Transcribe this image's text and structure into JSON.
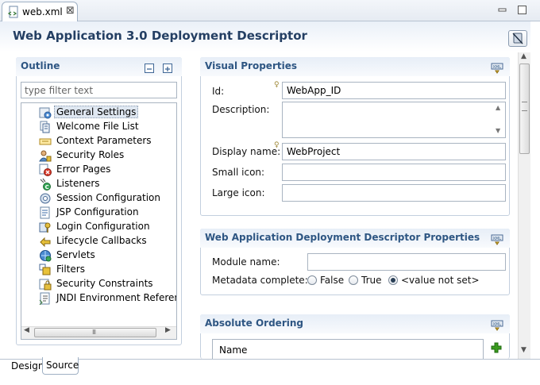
{
  "editor_tab": {
    "label": "web.xml",
    "close_glyph": "⊠"
  },
  "page": {
    "title": "Web Application 3.0 Deployment Descriptor"
  },
  "outline": {
    "title": "Outline",
    "filter_placeholder": "type filter text",
    "items": [
      {
        "label": "General Settings",
        "icon": "general-settings-icon",
        "selected": true
      },
      {
        "label": "Welcome File List",
        "icon": "welcome-file-list-icon"
      },
      {
        "label": "Context Parameters",
        "icon": "context-parameters-icon"
      },
      {
        "label": "Security Roles",
        "icon": "security-roles-icon"
      },
      {
        "label": "Error Pages",
        "icon": "error-pages-icon"
      },
      {
        "label": "Listeners",
        "icon": "listeners-icon"
      },
      {
        "label": "Session Configuration",
        "icon": "session-configuration-icon"
      },
      {
        "label": "JSP Configuration",
        "icon": "jsp-configuration-icon"
      },
      {
        "label": "Login Configuration",
        "icon": "login-configuration-icon"
      },
      {
        "label": "Lifecycle Callbacks",
        "icon": "lifecycle-callbacks-icon"
      },
      {
        "label": "Servlets",
        "icon": "servlets-icon"
      },
      {
        "label": "Filters",
        "icon": "filters-icon"
      },
      {
        "label": "Security Constraints",
        "icon": "security-constraints-icon"
      },
      {
        "label": "JNDI Environment Reference",
        "icon": "jndi-environment-reference-icon"
      }
    ],
    "scroll_grip": "III"
  },
  "visual_properties": {
    "title": "Visual Properties",
    "id_label": "Id:",
    "id_value": "WebApp_ID",
    "description_label": "Description:",
    "description_value": "",
    "display_name_label": "Display name:",
    "display_name_value": "WebProject",
    "small_icon_label": "Small icon:",
    "small_icon_value": "",
    "large_icon_label": "Large icon:",
    "large_icon_value": ""
  },
  "dd_properties": {
    "title": "Web Application Deployment Descriptor Properties",
    "module_name_label": "Module name:",
    "module_name_value": "",
    "metadata_label": "Metadata complete:",
    "options": [
      "False",
      "True",
      "<value not set>"
    ],
    "selected_option": "<value not set>"
  },
  "absolute_ordering": {
    "title": "Absolute Ordering",
    "column_name": "Name"
  },
  "bottom_tabs": {
    "design": "Design",
    "source": "Source"
  },
  "colors": {
    "section_title": "#2e5683",
    "page_title": "#243f63",
    "accent_add": "#3a9a1e"
  }
}
